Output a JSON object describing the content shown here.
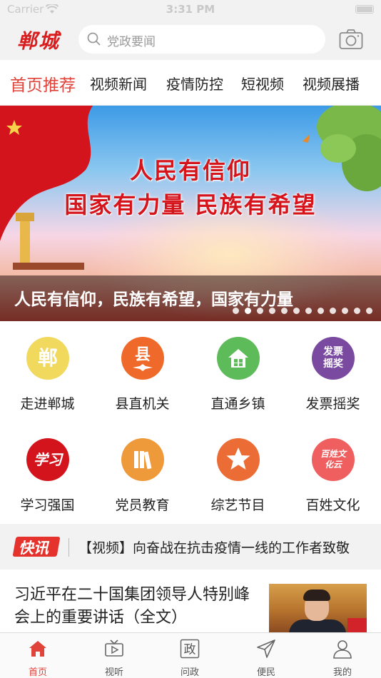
{
  "status_bar": {
    "carrier": "Carrier",
    "time": "3:31 PM"
  },
  "header": {
    "logo": "郸城",
    "search_placeholder": "党政要闻",
    "icons": {
      "search": "search-icon",
      "camera": "camera-icon"
    }
  },
  "tabs": [
    {
      "label": "首页推荐",
      "active": true
    },
    {
      "label": "视频新闻",
      "active": false
    },
    {
      "label": "疫情防控",
      "active": false
    },
    {
      "label": "短视频",
      "active": false
    },
    {
      "label": "视频展播",
      "active": false
    }
  ],
  "banner": {
    "headline_line1": "人民有信仰",
    "headline_line2": "国家有力量  民族有希望",
    "caption": "人民有信仰，民族有希望，国家有力量",
    "slide_count": 12,
    "active_slide": 1
  },
  "grid": [
    {
      "label": "走进郸城",
      "glyph": "郸",
      "color": "#f0d95c",
      "icon": "dancheng-icon"
    },
    {
      "label": "县直机关",
      "glyph": "县",
      "color": "#ef6a2a",
      "icon": "county-icon"
    },
    {
      "label": "直通乡镇",
      "glyph": "",
      "color": "#5dbb5a",
      "icon": "house-icon"
    },
    {
      "label": "发票摇奖",
      "glyph": "发票摇奖",
      "color": "#7a4aa0",
      "icon": "invoice-lottery-icon"
    },
    {
      "label": "学习强国",
      "glyph": "学习",
      "color": "#d3141c",
      "icon": "study-icon"
    },
    {
      "label": "党员教育",
      "glyph": "",
      "color": "#ee9a3a",
      "icon": "books-icon"
    },
    {
      "label": "综艺节目",
      "glyph": "",
      "color": "#ec6c36",
      "icon": "star-icon"
    },
    {
      "label": "百姓文化",
      "glyph": "百姓文化云",
      "color": "#ef5f5f",
      "icon": "culture-icon"
    }
  ],
  "ticker": {
    "badge": "快讯",
    "text": "【视频】向奋战在抗击疫情一线的工作者致敬"
  },
  "article": {
    "title": "习近平在二十国集团领导人特别峰会上的重要讲话（全文）"
  },
  "bottom_nav": [
    {
      "label": "首页",
      "icon": "home-icon",
      "active": true
    },
    {
      "label": "视听",
      "icon": "tv-icon",
      "active": false
    },
    {
      "label": "问政",
      "icon": "politics-icon",
      "active": false
    },
    {
      "label": "便民",
      "icon": "send-icon",
      "active": false
    },
    {
      "label": "我的",
      "icon": "profile-icon",
      "active": false
    }
  ],
  "colors": {
    "accent": "#e0433a",
    "brand_red": "#d81e1e"
  }
}
